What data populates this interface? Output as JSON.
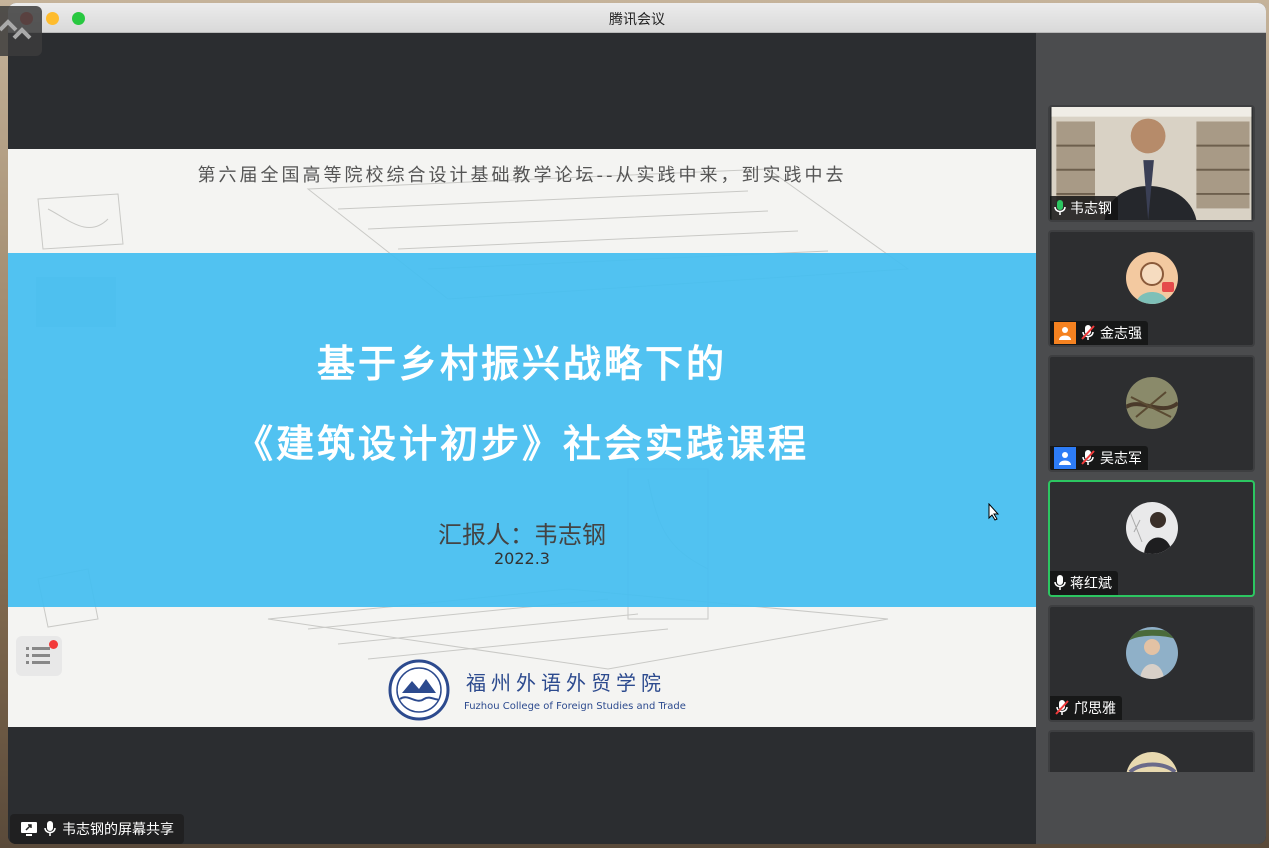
{
  "window": {
    "title": "腾讯会议"
  },
  "slide": {
    "forum_title": "第六届全国高等院校综合设计基础教学论坛--从实践中来，到实践中去",
    "main_title_line1": "基于乡村振兴战略下的",
    "main_title_line2": "《建筑设计初步》社会实践课程",
    "reporter": "汇报人：韦志钢",
    "date": "2022.3",
    "college_cn": "福州外语外贸学院",
    "college_en": "Fuzhou College of Foreign Studies and Trade",
    "band_color": "#48bff0"
  },
  "share": {
    "label": "韦志钢的屏幕共享"
  },
  "participants": [
    {
      "name": "韦志钢",
      "mic": "on",
      "badge": "none",
      "active": false,
      "video": true
    },
    {
      "name": "金志强",
      "mic": "muted",
      "badge": "orange-person",
      "active": false,
      "video": false
    },
    {
      "name": "吴志军",
      "mic": "muted",
      "badge": "blue-person",
      "active": false,
      "video": false
    },
    {
      "name": "蒋红斌",
      "mic": "on",
      "badge": "none",
      "active": true,
      "video": false
    },
    {
      "name": "邝思雅",
      "mic": "muted",
      "badge": "none",
      "active": false,
      "video": false
    }
  ],
  "colors": {
    "active_speaker": "#2cc661",
    "mic_on": "#2cc661",
    "mute_red": "#f23a3a"
  }
}
